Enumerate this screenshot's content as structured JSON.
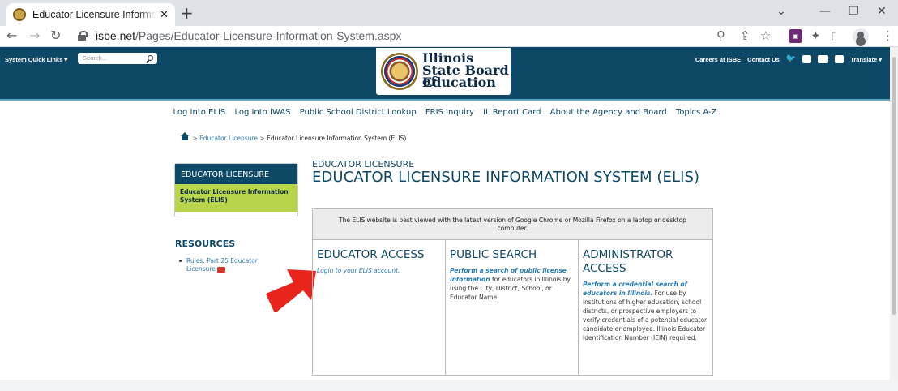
{
  "browser": {
    "tab_title": "Educator Licensure Information S",
    "tab_close": "✕",
    "new_tab": "+",
    "url_domain": "isbe.net",
    "url_path": "/Pages/Educator-Licensure-Information-System.aspx"
  },
  "site_header": {
    "quick_links": "System Quick Links ▾",
    "search_placeholder": "Search...",
    "logo_line1": "Illinois",
    "logo_line2": "State Board of",
    "logo_line3": "Education",
    "careers": "Careers at ISBE",
    "contact": "Contact Us",
    "translate": "Translate ▾"
  },
  "main_nav": [
    "Log Into ELIS",
    "Log Into IWAS",
    "Public School District Lookup",
    "FRIS Inquiry",
    "IL Report Card",
    "About the Agency and Board",
    "Topics A-Z"
  ],
  "breadcrumb": {
    "sep": ">",
    "level1": "Educator Licensure",
    "current": "Educator Licensure Information System (ELIS)"
  },
  "sidebar": {
    "heading": "EDUCATOR LICENSURE",
    "active_item": "Educator Licensure Information System (ELIS)",
    "resources_title": "RESOURCES",
    "resource_link": "Rules: Part 25 Educator Licensure"
  },
  "content": {
    "kicker": "EDUCATOR LICENSURE",
    "title": "EDUCATOR LICENSURE INFORMATION SYSTEM (ELIS)",
    "note": "The ELIS website is best viewed with the latest version of Google Chrome or Mozilla Firefox on a laptop or desktop computer.",
    "columns": [
      {
        "heading": "EDUCATOR ACCESS",
        "link": "Login to your ELIS account.",
        "text": ""
      },
      {
        "heading": "PUBLIC SEARCH",
        "link": "Perform a search of public license information",
        "text": " for educators in Illinois by using the City, District, School, or Educator Name."
      },
      {
        "heading": "ADMINISTRATOR ACCESS",
        "link": "Perform a credential search of educators in Illinois.",
        "text": " For use by institutions of higher education, school districts, or prospective employers to verify credentials of a potential educator candidate or employee. Illinois Educator Identification Number (IEIN) required."
      }
    ]
  },
  "colors": {
    "header_blue": "#0d4866",
    "active_green": "#b7d44a",
    "link_blue": "#2a7ab0",
    "arrow_red": "#e8241c"
  }
}
